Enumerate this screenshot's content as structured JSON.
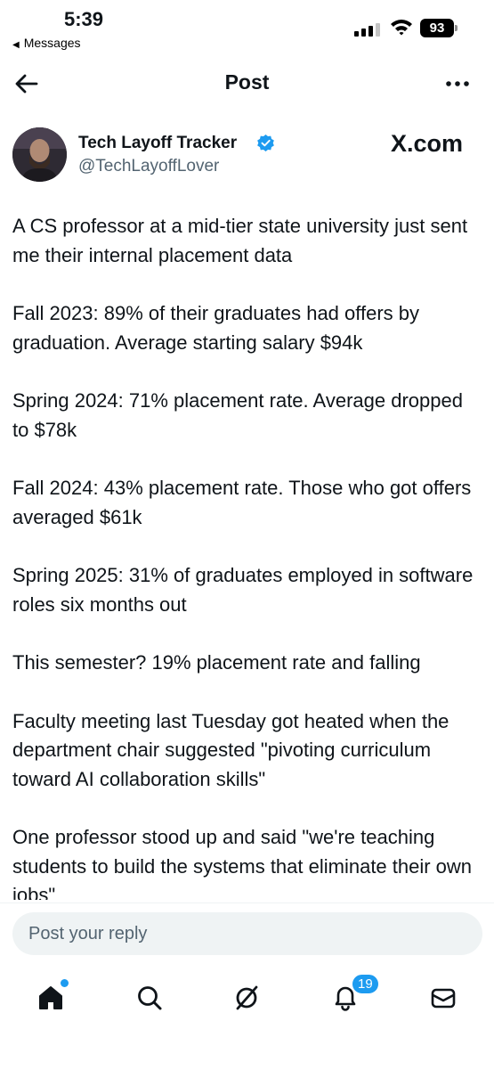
{
  "status_bar": {
    "time": "5:39",
    "back_label": "Messages",
    "battery": "93"
  },
  "header": {
    "title": "Post",
    "back_icon": "arrow-left-icon",
    "more_icon": "more-horizontal-icon"
  },
  "author": {
    "name": "Tech Layoff Tracker",
    "handle": "@TechLayoffLover",
    "verified": true,
    "watermark": "X.com"
  },
  "post": {
    "paragraphs": [
      "A CS professor at a mid-tier state university just sent me their internal placement data",
      "Fall 2023: 89% of their graduates had offers by graduation. Average starting salary $94k",
      "Spring 2024: 71% placement rate. Average dropped to $78k",
      "Fall 2024: 43% placement rate. Those who got offers averaged $61k",
      "Spring 2025: 31% of graduates employed in software roles six months out",
      "This semester? 19% placement rate and falling",
      "Faculty meeting last Tuesday got heated when the department chair suggested \"pivoting curriculum toward AI collaboration skills\"",
      "One professor stood up and said \"we're teaching students to build the systems that eliminate their own jobs\""
    ]
  },
  "reply": {
    "placeholder": "Post your reply"
  },
  "tab_bar": {
    "notifications_count": "19",
    "accent": "#1d9bf0"
  }
}
